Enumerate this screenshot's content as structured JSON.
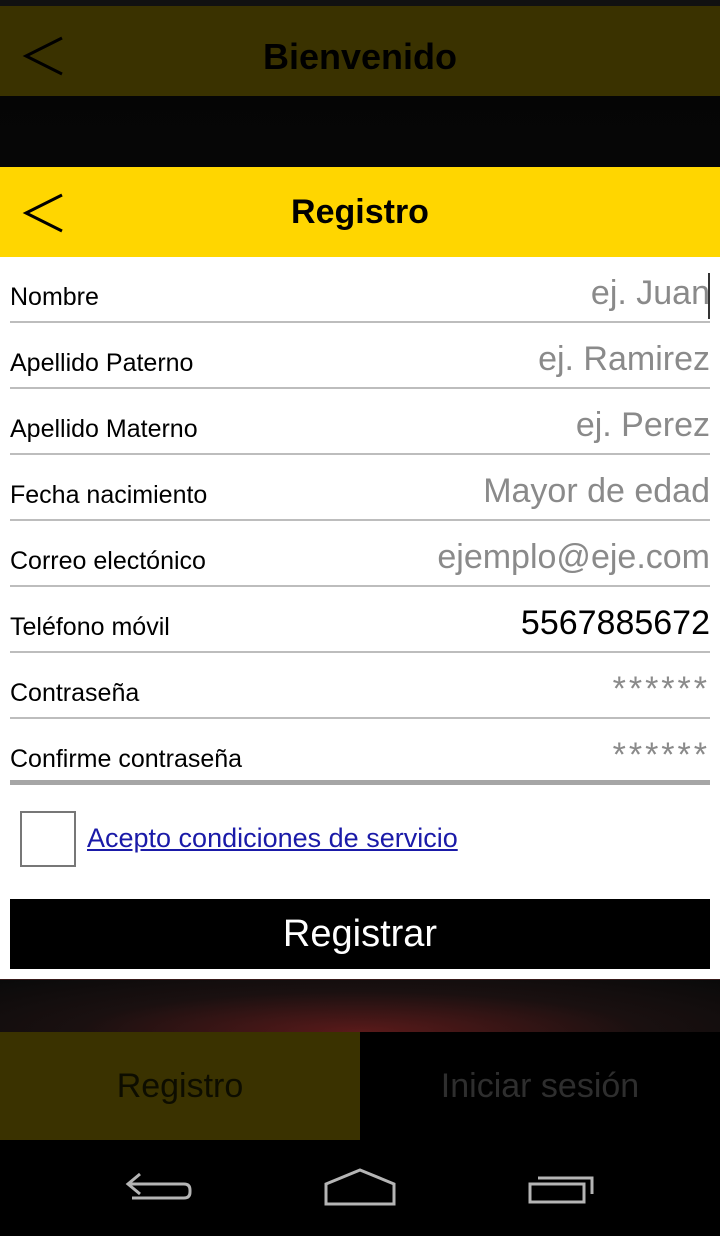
{
  "background": {
    "title": "Bienvenido",
    "tabs": [
      {
        "label": "Registro"
      },
      {
        "label": "Iniciar sesión"
      }
    ]
  },
  "dialog": {
    "title": "Registro",
    "fields": [
      {
        "label": "Nombre",
        "placeholder": "ej. Juan",
        "value": ""
      },
      {
        "label": "Apellido Paterno",
        "placeholder": "ej. Ramirez",
        "value": ""
      },
      {
        "label": "Apellido Materno",
        "placeholder": "ej. Perez",
        "value": ""
      },
      {
        "label": "Fecha nacimiento",
        "placeholder": "Mayor de edad",
        "value": ""
      },
      {
        "label": "Correo electónico",
        "placeholder": "ejemplo@eje.com",
        "value": ""
      },
      {
        "label": "Teléfono móvil",
        "placeholder": "",
        "value": "5567885672"
      },
      {
        "label": "Contraseña",
        "placeholder": "******",
        "value": ""
      },
      {
        "label": "Confirme contraseña",
        "placeholder": "******",
        "value": ""
      }
    ],
    "accept_label": "Acepto condiciones de servicio",
    "accept_checked": false,
    "submit_label": "Registrar"
  },
  "colors": {
    "accent": "#ffd600",
    "dim_accent": "#3a3200",
    "link": "#1a1aa8"
  },
  "icons": {
    "back": "chevron-left-icon",
    "nav_back": "back-arrow-icon",
    "nav_home": "home-icon",
    "nav_recents": "recents-icon"
  }
}
